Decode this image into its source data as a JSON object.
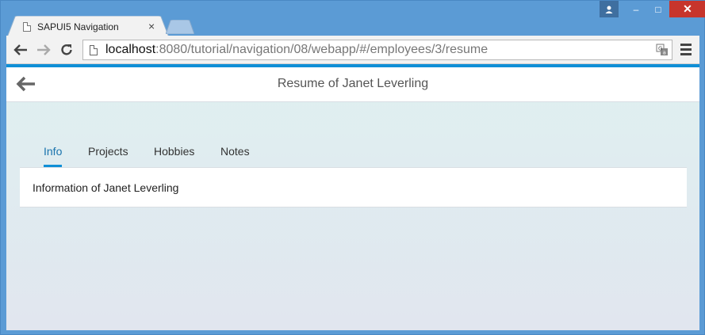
{
  "browser": {
    "tab_title": "SAPUI5 Navigation",
    "tab_close": "×",
    "url_host": "localhost",
    "url_rest": ":8080/tutorial/navigation/08/webapp/#/employees/3/resume",
    "window_controls": {
      "minimize": "–",
      "maximize": "□",
      "close": "✕"
    }
  },
  "app": {
    "title": "Resume of Janet Leverling",
    "tabs": [
      {
        "label": "Info",
        "selected": true
      },
      {
        "label": "Projects",
        "selected": false
      },
      {
        "label": "Hobbies",
        "selected": false
      },
      {
        "label": "Notes",
        "selected": false
      }
    ],
    "panel_text": "Information of Janet Leverling"
  },
  "colors": {
    "accent": "#0f8fd6",
    "selected_tab_text": "#1a73ad",
    "close_button": "#c7352c"
  },
  "icons": [
    "page-icon",
    "back-arrow-icon",
    "forward-arrow-icon",
    "reload-icon",
    "translate-icon",
    "menu-icon",
    "user-icon"
  ]
}
